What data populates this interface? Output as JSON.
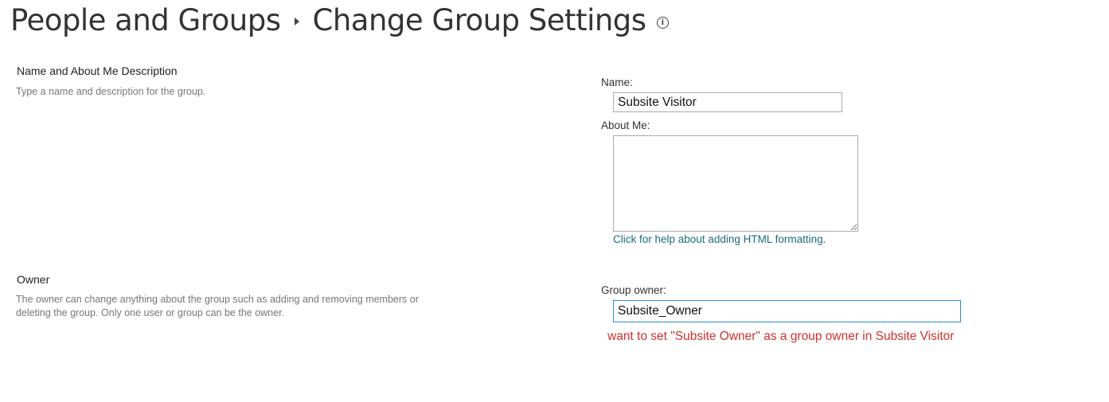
{
  "header": {
    "breadcrumb_root": "People and Groups",
    "page_title": "Change Group Settings",
    "info_icon": "info-icon"
  },
  "name_section": {
    "heading": "Name and About Me Description",
    "description": "Type a name and description for the group.",
    "name_label": "Name:",
    "name_value": "Subsite Visitor",
    "about_label": "About Me:",
    "about_value": "",
    "help_link": "Click for help about adding HTML formatting."
  },
  "owner_section": {
    "heading": "Owner",
    "description_line1": "The owner can change anything about the group such as adding and removing members or",
    "description_line2": "deleting the group. Only one user or group can be the owner.",
    "owner_label": "Group owner:",
    "owner_value": "Subsite_Owner"
  },
  "annotation": {
    "text": "want to set \"Subsite Owner\" as a group owner in Subsite Visitor",
    "color": "#d32f2f"
  },
  "colors": {
    "link": "#1e6c7d",
    "focus_border": "#2a8dd4"
  }
}
